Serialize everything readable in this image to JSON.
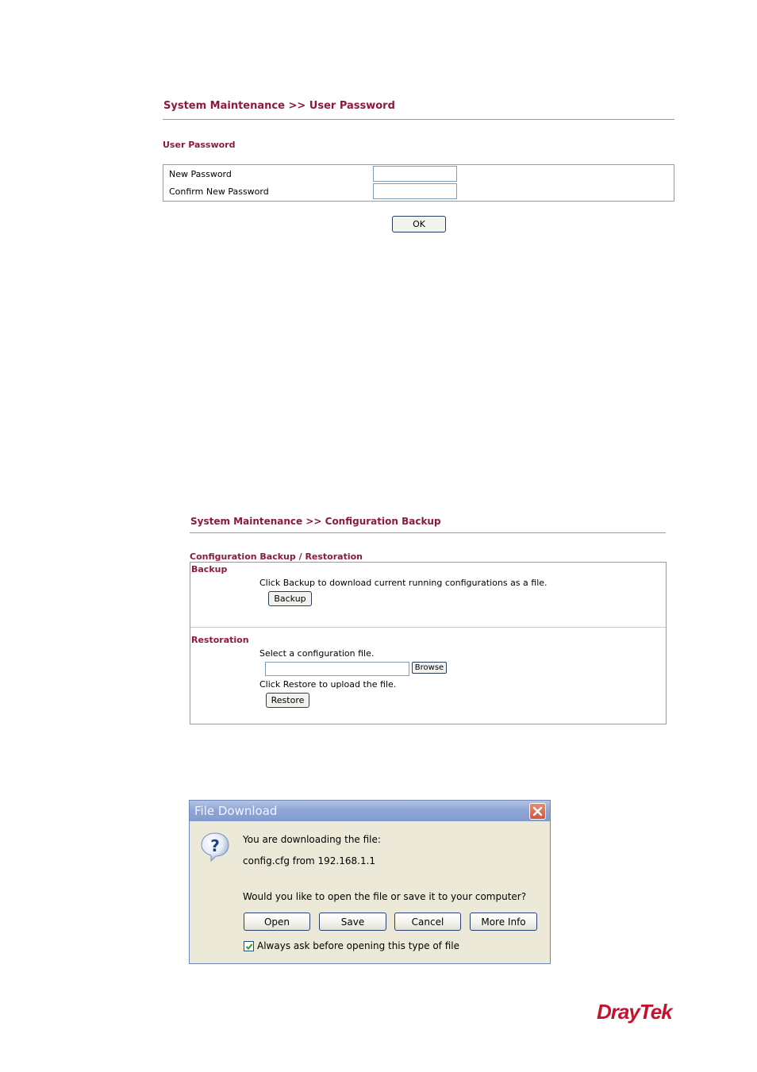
{
  "user_password": {
    "title": "System Maintenance >> User Password",
    "section_title": "User Password",
    "new_password_label": "New Password",
    "confirm_password_label": "Confirm New Password",
    "new_password_value": "",
    "confirm_password_value": "",
    "ok_label": "OK"
  },
  "config_backup": {
    "title": "System Maintenance >> Configuration Backup",
    "section_title": "Configuration Backup / Restoration",
    "backup_heading": "Backup",
    "backup_description": "Click Backup to download current running configurations as a file.",
    "backup_button": "Backup",
    "restoration_heading": "Restoration",
    "select_file_text": "Select a configuration file.",
    "file_value": "",
    "browse_button": "Browse",
    "restore_description": "Click Restore to upload the file.",
    "restore_button": "Restore"
  },
  "file_download": {
    "window_title": "File Download",
    "downloading_text": "You are downloading the file:",
    "file_text": "config.cfg from 192.168.1.1",
    "question_text": "Would you like to open the file or save it to your computer?",
    "open_button": "Open",
    "save_button": "Save",
    "cancel_button": "Cancel",
    "more_info_button": "More Info",
    "always_ask_label": "Always ask before opening this type of file",
    "always_ask_checked": true
  },
  "logo": {
    "text": "DrayTek",
    "color": "#c4122f"
  },
  "colors": {
    "heading": "#8b1a3c",
    "xp_titlebar": "#8fa6d6",
    "dialog_background": "#ece9d8"
  }
}
